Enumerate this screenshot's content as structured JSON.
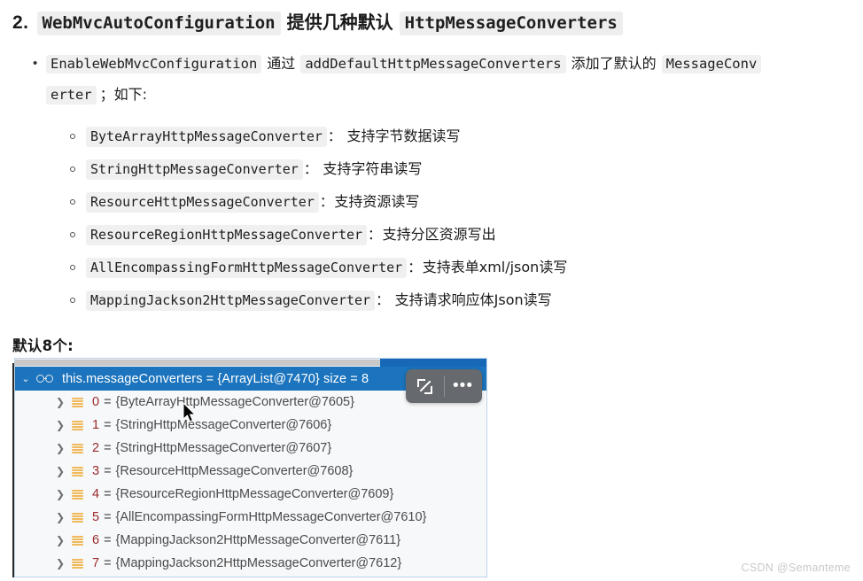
{
  "article": {
    "heading": {
      "number": "2.",
      "code1": "WebMvcAutoConfiguration",
      "middle": "提供几种默认",
      "code2": "HttpMessageConverters"
    },
    "bullet": {
      "marker": "•",
      "code1": "EnableWebMvcConfiguration",
      "text1": "通过",
      "code2": "addDefaultHttpMessageConverters",
      "text2": "添加了默认的",
      "code3": "MessageConv",
      "code3_wrap": "erter",
      "text3": "；如下:"
    },
    "sublist": [
      {
        "marker": "◦",
        "code": "ByteArrayHttpMessageConverter",
        "sep": "：",
        "desc": " 支持字节数据读写"
      },
      {
        "marker": "◦",
        "code": "StringHttpMessageConverter",
        "sep": "：",
        "desc": " 支持字符串读写"
      },
      {
        "marker": "◦",
        "code": "ResourceHttpMessageConverter",
        "sep": "：",
        "desc": "支持资源读写"
      },
      {
        "marker": "◦",
        "code": "ResourceRegionHttpMessageConverter",
        "sep": "：",
        "desc": "支持分区资源写出"
      },
      {
        "marker": "◦",
        "code": "AllEncompassingFormHttpMessageConverter",
        "sep": "：",
        "desc": "支持表单xml/json读写"
      },
      {
        "marker": "◦",
        "code": "MappingJackson2HttpMessageConverter",
        "sep": "：",
        "desc": " 支持请求响应体Json读写"
      }
    ],
    "note": "默认8个:"
  },
  "debugger": {
    "header": {
      "chevron": "⌄",
      "icon_name": "watches-glasses-icon",
      "text": "this.messageConverters = {ArrayList@7470}  size = 8"
    },
    "toolbar": {
      "expand_label": "",
      "more_label": "•••"
    },
    "rows": [
      {
        "arrow": "❯",
        "index": "0",
        "eq": "=",
        "value": "{ByteArrayHttpMessageConverter@7605}"
      },
      {
        "arrow": "❯",
        "index": "1",
        "eq": "=",
        "value": "{StringHttpMessageConverter@7606}"
      },
      {
        "arrow": "❯",
        "index": "2",
        "eq": "=",
        "value": "{StringHttpMessageConverter@7607}"
      },
      {
        "arrow": "❯",
        "index": "3",
        "eq": "=",
        "value": "{ResourceHttpMessageConverter@7608}"
      },
      {
        "arrow": "❯",
        "index": "4",
        "eq": "=",
        "value": "{ResourceRegionHttpMessageConverter@7609}"
      },
      {
        "arrow": "❯",
        "index": "5",
        "eq": "=",
        "value": "{AllEncompassingFormHttpMessageConverter@7610}"
      },
      {
        "arrow": "❯",
        "index": "6",
        "eq": "=",
        "value": "{MappingJackson2HttpMessageConverter@7611}"
      },
      {
        "arrow": "❯",
        "index": "7",
        "eq": "=",
        "value": "{MappingJackson2HttpMessageConverter@7612}"
      }
    ]
  },
  "watermark": "CSDN @Semanteme",
  "colors": {
    "header_blue": "#1b74bd",
    "scroll_blue": "#1769b8",
    "panel_bg": "#f7f8fa",
    "panel_border": "#bcd3e8",
    "code_bg": "#f0f0f0",
    "index_red": "#9b2a2a",
    "list_icon_orange": "#f0b95a",
    "toolbar_gray": "#666a6e"
  }
}
